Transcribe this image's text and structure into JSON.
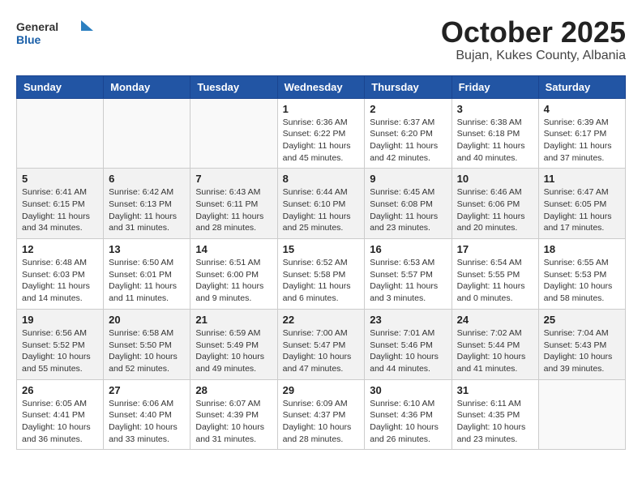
{
  "header": {
    "logo_general": "General",
    "logo_blue": "Blue",
    "month_title": "October 2025",
    "location": "Bujan, Kukes County, Albania"
  },
  "days_of_week": [
    "Sunday",
    "Monday",
    "Tuesday",
    "Wednesday",
    "Thursday",
    "Friday",
    "Saturday"
  ],
  "weeks": [
    [
      {
        "day": "",
        "info": ""
      },
      {
        "day": "",
        "info": ""
      },
      {
        "day": "",
        "info": ""
      },
      {
        "day": "1",
        "info": "Sunrise: 6:36 AM\nSunset: 6:22 PM\nDaylight: 11 hours\nand 45 minutes."
      },
      {
        "day": "2",
        "info": "Sunrise: 6:37 AM\nSunset: 6:20 PM\nDaylight: 11 hours\nand 42 minutes."
      },
      {
        "day": "3",
        "info": "Sunrise: 6:38 AM\nSunset: 6:18 PM\nDaylight: 11 hours\nand 40 minutes."
      },
      {
        "day": "4",
        "info": "Sunrise: 6:39 AM\nSunset: 6:17 PM\nDaylight: 11 hours\nand 37 minutes."
      }
    ],
    [
      {
        "day": "5",
        "info": "Sunrise: 6:41 AM\nSunset: 6:15 PM\nDaylight: 11 hours\nand 34 minutes."
      },
      {
        "day": "6",
        "info": "Sunrise: 6:42 AM\nSunset: 6:13 PM\nDaylight: 11 hours\nand 31 minutes."
      },
      {
        "day": "7",
        "info": "Sunrise: 6:43 AM\nSunset: 6:11 PM\nDaylight: 11 hours\nand 28 minutes."
      },
      {
        "day": "8",
        "info": "Sunrise: 6:44 AM\nSunset: 6:10 PM\nDaylight: 11 hours\nand 25 minutes."
      },
      {
        "day": "9",
        "info": "Sunrise: 6:45 AM\nSunset: 6:08 PM\nDaylight: 11 hours\nand 23 minutes."
      },
      {
        "day": "10",
        "info": "Sunrise: 6:46 AM\nSunset: 6:06 PM\nDaylight: 11 hours\nand 20 minutes."
      },
      {
        "day": "11",
        "info": "Sunrise: 6:47 AM\nSunset: 6:05 PM\nDaylight: 11 hours\nand 17 minutes."
      }
    ],
    [
      {
        "day": "12",
        "info": "Sunrise: 6:48 AM\nSunset: 6:03 PM\nDaylight: 11 hours\nand 14 minutes."
      },
      {
        "day": "13",
        "info": "Sunrise: 6:50 AM\nSunset: 6:01 PM\nDaylight: 11 hours\nand 11 minutes."
      },
      {
        "day": "14",
        "info": "Sunrise: 6:51 AM\nSunset: 6:00 PM\nDaylight: 11 hours\nand 9 minutes."
      },
      {
        "day": "15",
        "info": "Sunrise: 6:52 AM\nSunset: 5:58 PM\nDaylight: 11 hours\nand 6 minutes."
      },
      {
        "day": "16",
        "info": "Sunrise: 6:53 AM\nSunset: 5:57 PM\nDaylight: 11 hours\nand 3 minutes."
      },
      {
        "day": "17",
        "info": "Sunrise: 6:54 AM\nSunset: 5:55 PM\nDaylight: 11 hours\nand 0 minutes."
      },
      {
        "day": "18",
        "info": "Sunrise: 6:55 AM\nSunset: 5:53 PM\nDaylight: 10 hours\nand 58 minutes."
      }
    ],
    [
      {
        "day": "19",
        "info": "Sunrise: 6:56 AM\nSunset: 5:52 PM\nDaylight: 10 hours\nand 55 minutes."
      },
      {
        "day": "20",
        "info": "Sunrise: 6:58 AM\nSunset: 5:50 PM\nDaylight: 10 hours\nand 52 minutes."
      },
      {
        "day": "21",
        "info": "Sunrise: 6:59 AM\nSunset: 5:49 PM\nDaylight: 10 hours\nand 49 minutes."
      },
      {
        "day": "22",
        "info": "Sunrise: 7:00 AM\nSunset: 5:47 PM\nDaylight: 10 hours\nand 47 minutes."
      },
      {
        "day": "23",
        "info": "Sunrise: 7:01 AM\nSunset: 5:46 PM\nDaylight: 10 hours\nand 44 minutes."
      },
      {
        "day": "24",
        "info": "Sunrise: 7:02 AM\nSunset: 5:44 PM\nDaylight: 10 hours\nand 41 minutes."
      },
      {
        "day": "25",
        "info": "Sunrise: 7:04 AM\nSunset: 5:43 PM\nDaylight: 10 hours\nand 39 minutes."
      }
    ],
    [
      {
        "day": "26",
        "info": "Sunrise: 6:05 AM\nSunset: 4:41 PM\nDaylight: 10 hours\nand 36 minutes."
      },
      {
        "day": "27",
        "info": "Sunrise: 6:06 AM\nSunset: 4:40 PM\nDaylight: 10 hours\nand 33 minutes."
      },
      {
        "day": "28",
        "info": "Sunrise: 6:07 AM\nSunset: 4:39 PM\nDaylight: 10 hours\nand 31 minutes."
      },
      {
        "day": "29",
        "info": "Sunrise: 6:09 AM\nSunset: 4:37 PM\nDaylight: 10 hours\nand 28 minutes."
      },
      {
        "day": "30",
        "info": "Sunrise: 6:10 AM\nSunset: 4:36 PM\nDaylight: 10 hours\nand 26 minutes."
      },
      {
        "day": "31",
        "info": "Sunrise: 6:11 AM\nSunset: 4:35 PM\nDaylight: 10 hours\nand 23 minutes."
      },
      {
        "day": "",
        "info": ""
      }
    ]
  ]
}
